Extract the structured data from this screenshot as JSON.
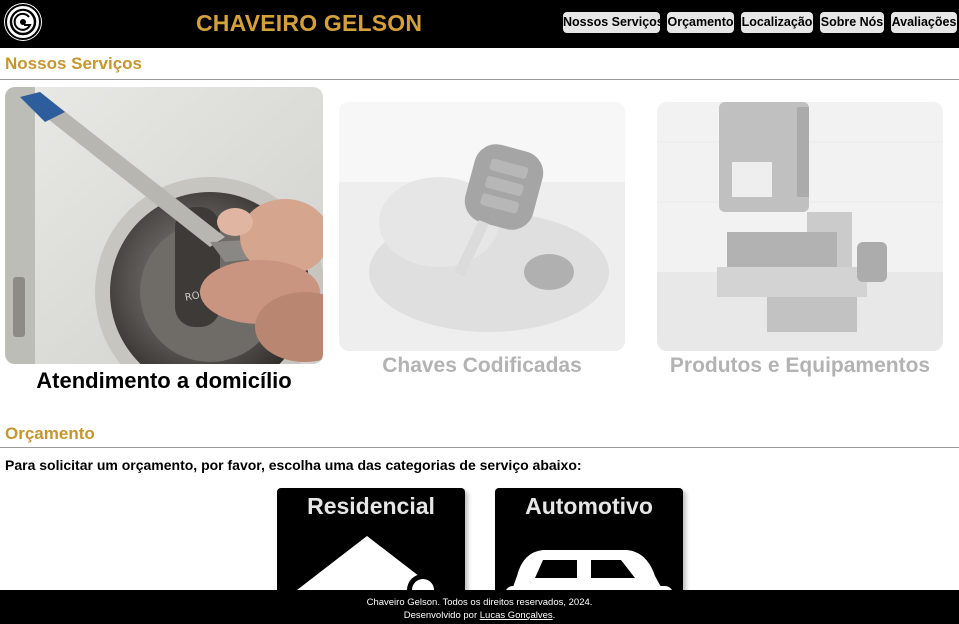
{
  "header": {
    "brand": "CHAVEIRO GELSON",
    "logo_icon": "key-circle-logo-icon",
    "brand_color": "#d4a03a",
    "nav": [
      "Nossos Serviços",
      "Orçamento",
      "Localização",
      "Sobre Nós",
      "Avaliações"
    ]
  },
  "services": {
    "title": "Nossos Serviços",
    "cards": [
      {
        "label": "Atendimento a domicílio",
        "active": true
      },
      {
        "label": "Chaves Codificadas",
        "active": false
      },
      {
        "label": "Produtos e Equipamentos",
        "active": false
      }
    ]
  },
  "quote": {
    "title": "Orçamento",
    "intro": "Para solicitar um orçamento, por favor, escolha uma das categorias de serviço abaixo:",
    "categories": [
      {
        "label": "Residencial",
        "icon": "house-icon"
      },
      {
        "label": "Automotivo",
        "icon": "car-icon"
      }
    ]
  },
  "footer": {
    "copyright": "Chaveiro Gelson. Todos os direitos reservados, 2024.",
    "dev_prefix": "Desenvolvido por ",
    "dev_name": "Lucas Gonçalves",
    "dev_suffix": "."
  },
  "colors": {
    "accent": "#c5962f",
    "header_bg": "#000000",
    "nav_bg": "#e6e6e6"
  }
}
